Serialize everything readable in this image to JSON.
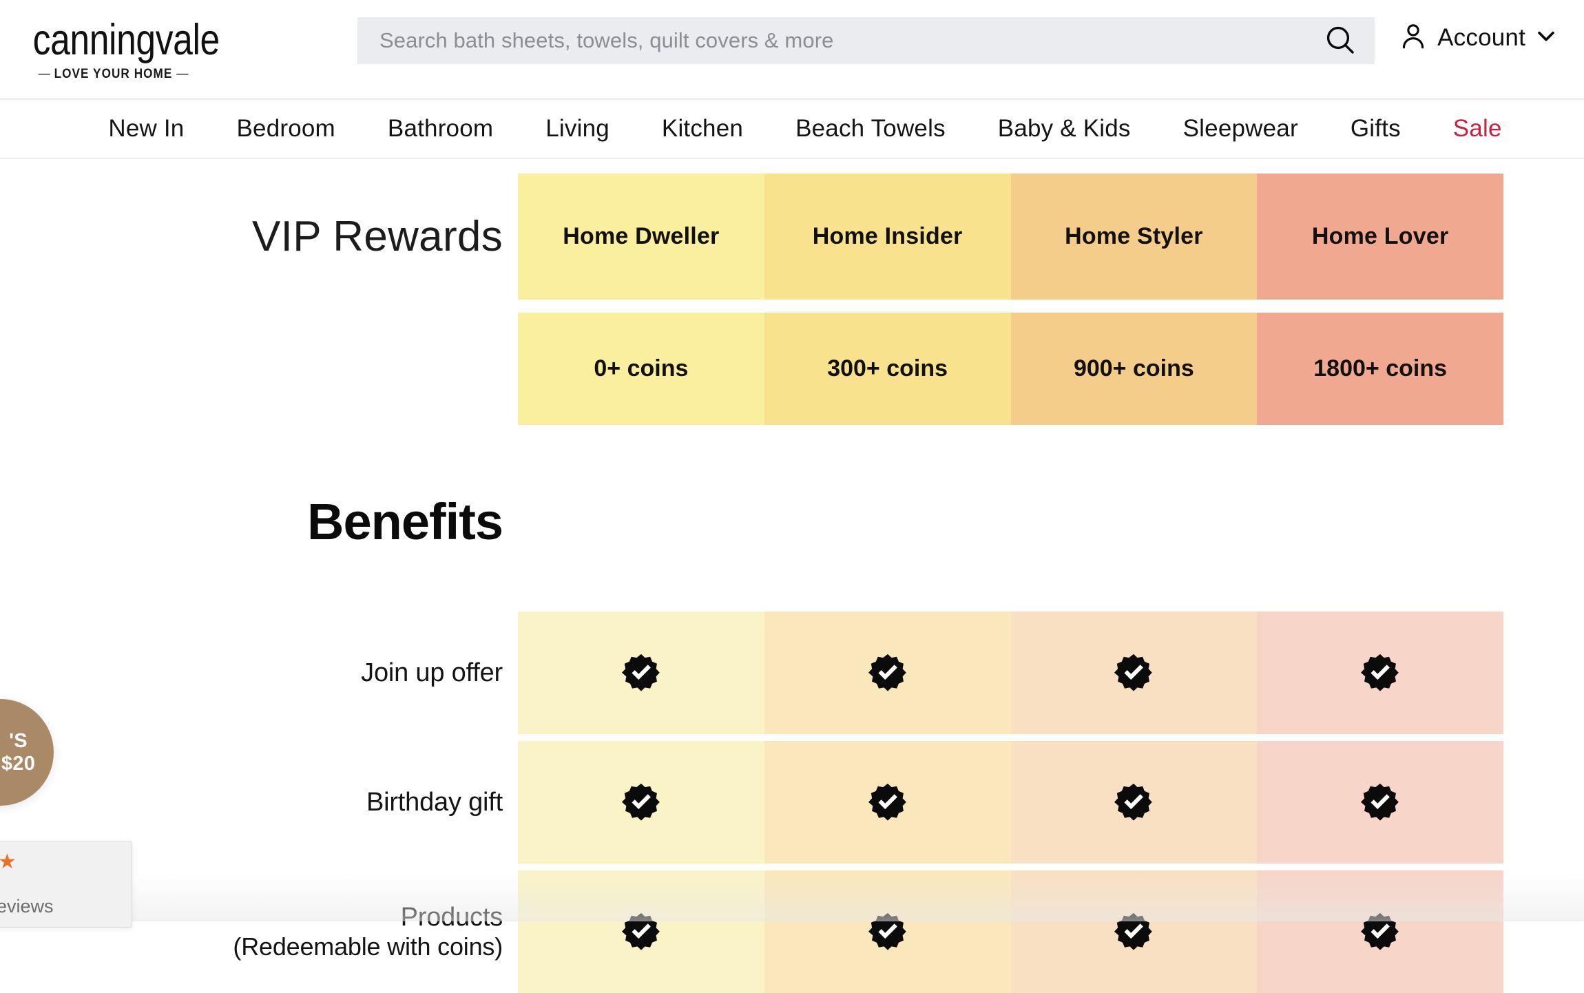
{
  "brand": {
    "name": "canningvale",
    "tagline_dash": "—",
    "tagline": "LOVE YOUR HOME"
  },
  "search": {
    "placeholder": "Search bath sheets, towels, quilt covers & more",
    "value": "",
    "icon": "search-icon"
  },
  "account": {
    "label": "Account",
    "icon": "user-icon",
    "chevron": "chevron-down-icon"
  },
  "nav": {
    "items": [
      {
        "label": "New In",
        "sale": false
      },
      {
        "label": "Bedroom",
        "sale": false
      },
      {
        "label": "Bathroom",
        "sale": false
      },
      {
        "label": "Living",
        "sale": false
      },
      {
        "label": "Kitchen",
        "sale": false
      },
      {
        "label": "Beach Towels",
        "sale": false
      },
      {
        "label": "Baby & Kids",
        "sale": false
      },
      {
        "label": "Sleepwear",
        "sale": false
      },
      {
        "label": "Gifts",
        "sale": false
      },
      {
        "label": "Sale",
        "sale": true
      }
    ],
    "sale_color": "#c8203f"
  },
  "vip": {
    "title": "VIP Rewards",
    "tiers": [
      {
        "name": "Home Dweller",
        "coins": "0+ coins",
        "color": "#f9ef9e",
        "tint": "#fbf3c8"
      },
      {
        "name": "Home Insider",
        "coins": "300+ coins",
        "color": "#f8e28d",
        "tint": "#fae8bc"
      },
      {
        "name": "Home Styler",
        "coins": "900+ coins",
        "color": "#f5cd8b",
        "tint": "#f9e0c2"
      },
      {
        "name": "Home Lover",
        "coins": "1800+ coins",
        "color": "#f0a890",
        "tint": "#f7d5c8"
      }
    ]
  },
  "benefits": {
    "heading": "Benefits",
    "check_icon": "verified-check-icon",
    "rows": [
      {
        "label": "Join up offer",
        "sub": "",
        "checks": [
          true,
          true,
          true,
          true
        ]
      },
      {
        "label": "Birthday gift",
        "sub": "",
        "checks": [
          true,
          true,
          true,
          true
        ]
      },
      {
        "label": "Products",
        "sub": "(Redeemable with coins)",
        "checks": [
          true,
          true,
          true,
          true
        ]
      }
    ]
  },
  "widgets": {
    "reward_bubble": {
      "line1": "'S",
      "line2": "$20",
      "color": "#a98966"
    },
    "reviews": {
      "text": "eviews",
      "star": "★",
      "star_color": "#e8722a"
    }
  }
}
